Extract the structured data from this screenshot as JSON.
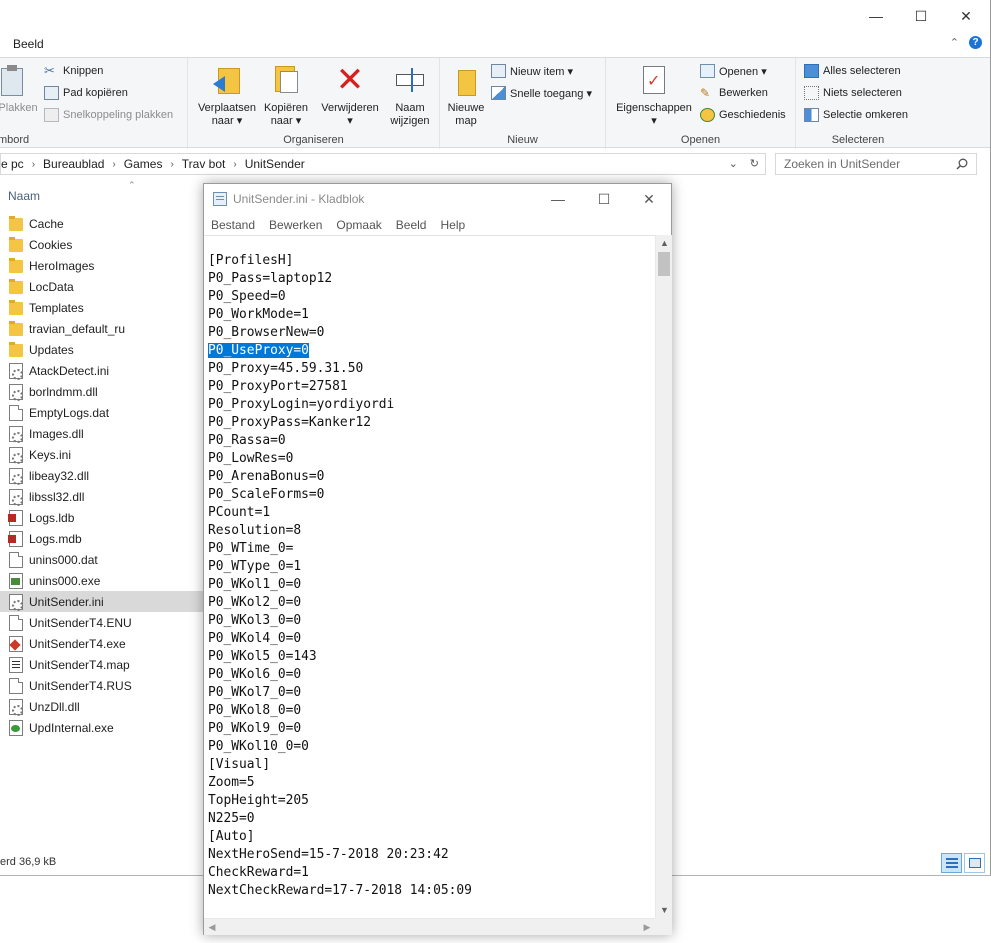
{
  "explorer": {
    "window_controls": {
      "minimize": "—",
      "maximize": "☐",
      "close": "✕"
    },
    "ribbon_tab": "Beeld",
    "ribbon": {
      "clipboard": {
        "paste": "Plakken",
        "cut": "Knippen",
        "copy_path": "Pad kopiëren",
        "paste_shortcut": "Snelkoppeling plakken",
        "label": "mbord"
      },
      "organize": {
        "move_to": "Verplaatsen\nnaar ▾",
        "copy_to": "Kopiëren\nnaar ▾",
        "delete": "Verwijderen\n▾",
        "rename": "Naam\nwijzigen",
        "label": "Organiseren"
      },
      "new": {
        "new_folder": "Nieuwe\nmap",
        "new_item": "Nieuw item ▾",
        "easy_access": "Snelle toegang ▾",
        "label": "Nieuw"
      },
      "open": {
        "properties": "Eigenschappen\n▾",
        "open": "Openen ▾",
        "edit": "Bewerken",
        "history": "Geschiedenis",
        "label": "Openen"
      },
      "select": {
        "select_all": "Alles selecteren",
        "select_none": "Niets selecteren",
        "invert": "Selectie omkeren",
        "label": "Selecteren"
      }
    },
    "address": {
      "crumbs": [
        "e pc",
        "Bureaublad",
        "Games",
        "Trav bot",
        "UnitSender"
      ],
      "search_placeholder": "Zoeken in UnitSender"
    },
    "column_header": "Naam",
    "files": [
      {
        "name": "Cache",
        "type": "folder"
      },
      {
        "name": "Cookies",
        "type": "folder"
      },
      {
        "name": "HeroImages",
        "type": "folder"
      },
      {
        "name": "LocData",
        "type": "folder"
      },
      {
        "name": "Templates",
        "type": "folder"
      },
      {
        "name": "travian_default_ru",
        "type": "folder"
      },
      {
        "name": "Updates",
        "type": "folder"
      },
      {
        "name": "AtackDetect.ini",
        "type": "gear"
      },
      {
        "name": "borlndmm.dll",
        "type": "gear"
      },
      {
        "name": "EmptyLogs.dat",
        "type": "doc"
      },
      {
        "name": "Images.dll",
        "type": "gear"
      },
      {
        "name": "Keys.ini",
        "type": "gear"
      },
      {
        "name": "libeay32.dll",
        "type": "gear"
      },
      {
        "name": "libssl32.dll",
        "type": "gear"
      },
      {
        "name": "Logs.ldb",
        "type": "access"
      },
      {
        "name": "Logs.mdb",
        "type": "access"
      },
      {
        "name": "unins000.dat",
        "type": "doc"
      },
      {
        "name": "unins000.exe",
        "type": "exe"
      },
      {
        "name": "UnitSender.ini",
        "type": "gear",
        "selected": true
      },
      {
        "name": "UnitSenderT4.ENU",
        "type": "doc"
      },
      {
        "name": "UnitSenderT4.exe",
        "type": "exe2"
      },
      {
        "name": "UnitSenderT4.map",
        "type": "mapdoc"
      },
      {
        "name": "UnitSenderT4.RUS",
        "type": "doc"
      },
      {
        "name": "UnzDll.dll",
        "type": "gear"
      },
      {
        "name": "UpdInternal.exe",
        "type": "exe3"
      }
    ],
    "status": "erd  36,9 kB"
  },
  "notepad": {
    "title": "UnitSender.ini - Kladblok",
    "window_controls": {
      "minimize": "—",
      "maximize": "☐",
      "close": "✕"
    },
    "menu": [
      "Bestand",
      "Bewerken",
      "Opmaak",
      "Beeld",
      "Help"
    ],
    "highlighted_line": 5,
    "lines": [
      "[ProfilesH]",
      "P0_Pass=laptop12",
      "P0_Speed=0",
      "P0_WorkMode=1",
      "P0_BrowserNew=0",
      "P0_UseProxy=0",
      "P0_Proxy=45.59.31.50",
      "P0_ProxyPort=27581",
      "P0_ProxyLogin=yordiyordi",
      "P0_ProxyPass=Kanker12",
      "P0_Rassa=0",
      "P0_LowRes=0",
      "P0_ArenaBonus=0",
      "P0_ScaleForms=0",
      "PCount=1",
      "Resolution=8",
      "P0_WTime_0=",
      "P0_WType_0=1",
      "P0_WKol1_0=0",
      "P0_WKol2_0=0",
      "P0_WKol3_0=0",
      "P0_WKol4_0=0",
      "P0_WKol5_0=143",
      "P0_WKol6_0=0",
      "P0_WKol7_0=0",
      "P0_WKol8_0=0",
      "P0_WKol9_0=0",
      "P0_WKol10_0=0",
      "[Visual]",
      "Zoom=5",
      "TopHeight=205",
      "N225=0",
      "[Auto]",
      "NextHeroSend=15-7-2018 20:23:42",
      "CheckReward=1",
      "NextCheckReward=17-7-2018 14:05:09"
    ]
  }
}
